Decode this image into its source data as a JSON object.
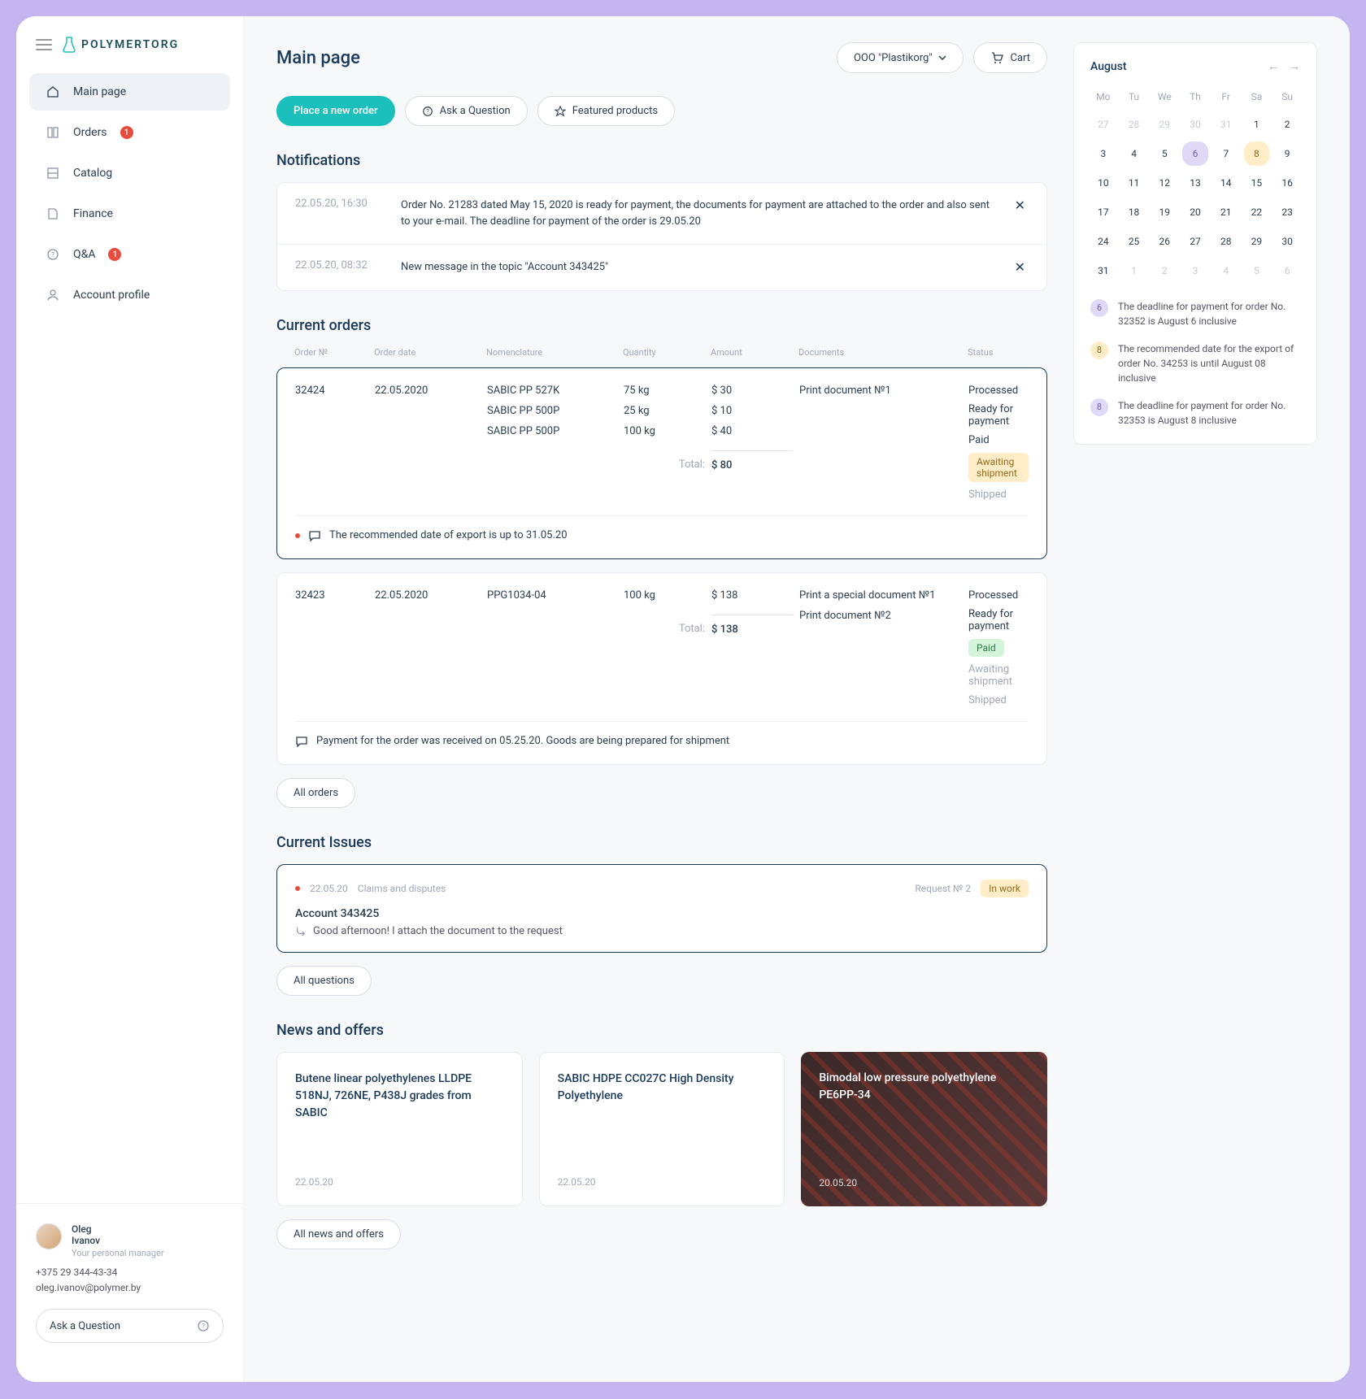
{
  "brand": "POLYMERTORG",
  "header": {
    "title": "Main page",
    "company": "OOO \"Plastikorg\"",
    "cart": "Cart"
  },
  "actions": {
    "place": "Place a new order",
    "ask": "Ask a Question",
    "featured": "Featured products"
  },
  "nav": {
    "main": "Main page",
    "orders": "Orders",
    "orders_badge": "1",
    "catalog": "Catalog",
    "finance": "Finance",
    "qa": "Q&A",
    "qa_badge": "1",
    "profile": "Account profile"
  },
  "manager": {
    "name": "Oleg",
    "surname": "Ivanov",
    "role": "Your personal manager",
    "phone": "+375 29 344-43-34",
    "email": "oleg.ivanov@polymer.by",
    "ask": "Ask a Question"
  },
  "sections": {
    "notifications": "Notifications",
    "orders": "Current orders",
    "issues": "Current Issues",
    "news": "News and offers"
  },
  "notifications": [
    {
      "time": "22.05.20, 16:30",
      "text": "Order No. 21283 dated May 15, 2020 is ready for payment, the documents for payment are attached to the order and also sent to your e-mail. The deadline for payment of the order is 29.05.20"
    },
    {
      "time": "22.05.20, 08:32",
      "text": "New message in the topic \"Account 343425\""
    }
  ],
  "orders_table": {
    "cols": {
      "no": "Order №",
      "date": "Order date",
      "nom": "Nomenclature",
      "qty": "Quantity",
      "amt": "Amount",
      "docs": "Documents",
      "status": "Status"
    },
    "total_label": "Total:"
  },
  "orders": [
    {
      "no": "32424",
      "date": "22.05.2020",
      "lines": [
        {
          "nom": "SABIC PP 527K",
          "qty": "75 kg",
          "amt": "$ 30"
        },
        {
          "nom": "SABIC PP 500P",
          "qty": "25 kg",
          "amt": "$ 10"
        },
        {
          "nom": "SABIC PP 500P",
          "qty": "100 kg",
          "amt": "$ 40"
        }
      ],
      "total": "$ 80",
      "docs": [
        "Print document №1"
      ],
      "statuses": [
        {
          "t": "Processed",
          "k": "n"
        },
        {
          "t": "Ready for payment",
          "k": "n"
        },
        {
          "t": "Paid",
          "k": "n"
        },
        {
          "t": "Awaiting shipment",
          "k": "yellow"
        },
        {
          "t": "Shipped",
          "k": "m"
        }
      ],
      "note": "The recommended date of export is up to 31.05.20",
      "note_red": true,
      "hl": true
    },
    {
      "no": "32423",
      "date": "22.05.2020",
      "lines": [
        {
          "nom": "PPG1034-04",
          "qty": "100 kg",
          "amt": "$ 138"
        }
      ],
      "total": "$ 138",
      "docs": [
        "Print a special document №1",
        "Print document №2"
      ],
      "statuses": [
        {
          "t": "Processed",
          "k": "n"
        },
        {
          "t": "Ready for payment",
          "k": "n"
        },
        {
          "t": "Paid",
          "k": "green"
        },
        {
          "t": "Awaiting shipment",
          "k": "m"
        },
        {
          "t": "Shipped",
          "k": "m"
        }
      ],
      "note": "Payment for the order was received on 05.25.20. Goods are being prepared for shipment",
      "note_red": false,
      "hl": false
    }
  ],
  "all_orders": "All orders",
  "issue": {
    "date": "22.05.20",
    "cat": "Claims and disputes",
    "req": "Request № 2",
    "status": "In work",
    "title": "Account 343425",
    "msg": "Good afternoon! I attach the document to the request"
  },
  "all_questions": "All questions",
  "news": [
    {
      "title": "Butene linear polyethylenes LLDPE 518NJ, 726NE, P438J grades from SABIC",
      "date": "22.05.20"
    },
    {
      "title": "SABIC HDPE CC027C High Density Polyethylene",
      "date": "22.05.20"
    },
    {
      "title": "Bimodal low pressure polyethylene PE6PP-34",
      "date": "20.05.20",
      "dark": true
    }
  ],
  "all_news": "All news and offers",
  "calendar": {
    "month": "August",
    "dow": [
      "Mo",
      "Tu",
      "We",
      "Th",
      "Fr",
      "Sa",
      "Su"
    ],
    "cells": [
      {
        "d": "27",
        "m": 1
      },
      {
        "d": "28",
        "m": 1
      },
      {
        "d": "29",
        "m": 1
      },
      {
        "d": "30",
        "m": 1
      },
      {
        "d": "31",
        "m": 1
      },
      {
        "d": "1"
      },
      {
        "d": "2"
      },
      {
        "d": "3"
      },
      {
        "d": "4"
      },
      {
        "d": "5"
      },
      {
        "d": "6",
        "c": "purple"
      },
      {
        "d": "7"
      },
      {
        "d": "8",
        "c": "amber"
      },
      {
        "d": "9"
      },
      {
        "d": "10"
      },
      {
        "d": "11"
      },
      {
        "d": "12"
      },
      {
        "d": "13"
      },
      {
        "d": "14"
      },
      {
        "d": "15"
      },
      {
        "d": "16"
      },
      {
        "d": "17"
      },
      {
        "d": "18"
      },
      {
        "d": "19"
      },
      {
        "d": "20"
      },
      {
        "d": "21"
      },
      {
        "d": "22"
      },
      {
        "d": "23"
      },
      {
        "d": "24"
      },
      {
        "d": "25"
      },
      {
        "d": "26"
      },
      {
        "d": "27"
      },
      {
        "d": "28"
      },
      {
        "d": "29"
      },
      {
        "d": "30"
      },
      {
        "d": "31"
      },
      {
        "d": "1",
        "m": 1
      },
      {
        "d": "2",
        "m": 1
      },
      {
        "d": "3",
        "m": 1
      },
      {
        "d": "4",
        "m": 1
      },
      {
        "d": "5",
        "m": 1
      },
      {
        "d": "6",
        "m": 1
      }
    ],
    "events": [
      {
        "n": "6",
        "c": "purple",
        "t": "The deadline for payment for order No. 32352 is August 6 inclusive"
      },
      {
        "n": "8",
        "c": "amber",
        "t": "The recommended date for the export of order No. 34253 is until August 08 inclusive"
      },
      {
        "n": "8",
        "c": "purple",
        "t": "The deadline for payment for order No. 32353 is August 8 inclusive"
      }
    ]
  }
}
